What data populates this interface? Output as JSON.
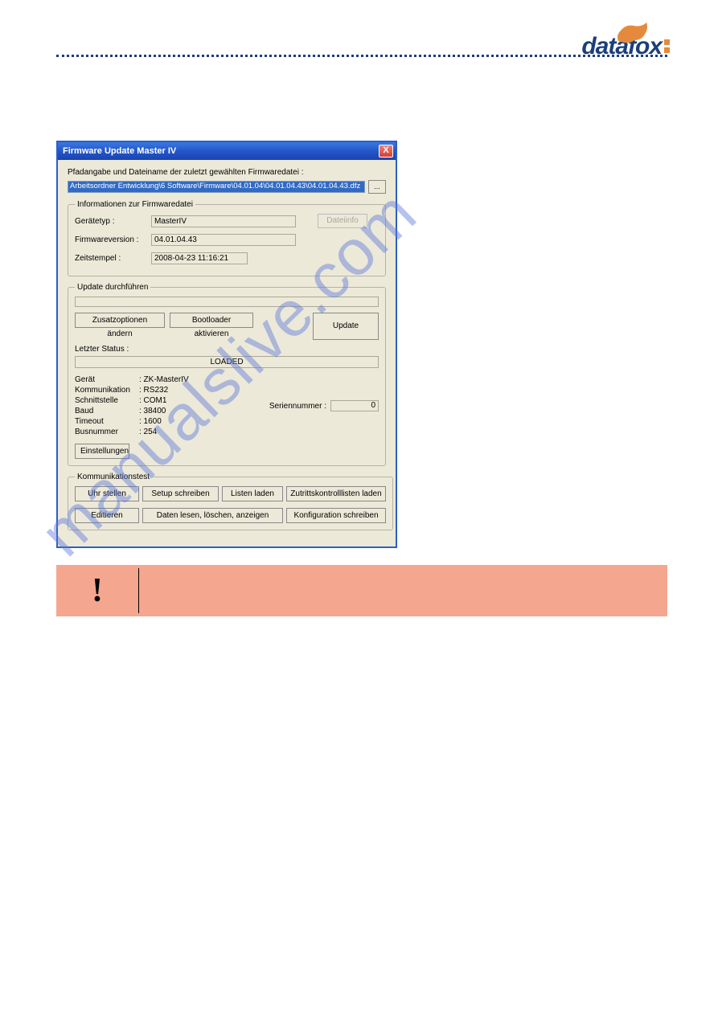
{
  "logo": {
    "text": "datafox"
  },
  "dialog": {
    "title": "Firmware Update Master IV",
    "close_label": "X",
    "path_section_label": "Pfadangabe und Dateiname der zuletzt gewählten Firmwaredatei :",
    "path_value": "Arbeitsordner Entwicklung\\6 Software\\Firmware\\04.01.04\\04.01.04.43\\04.01.04.43.dfz",
    "browse_label": "...",
    "info": {
      "legend": "Informationen zur Firmwaredatei",
      "type_label": "Gerätetyp :",
      "type_value": "MasterIV",
      "version_label": "Firmwareversion :",
      "version_value": "04.01.04.43",
      "timestamp_label": "Zeitstempel :",
      "timestamp_value": "2008-04-23 11:16:21",
      "dateinfo_label": "Dateiinfo"
    },
    "update": {
      "legend": "Update durchführen",
      "addopts_label": "Zusatzoptionen ändern",
      "bootloader_label": "Bootloader aktivieren",
      "update_label": "Update",
      "lastStatus_label": "Letzter Status :",
      "status_value": "LOADED",
      "device": {
        "geraet_label": "Gerät",
        "geraet_value": ": ZK-MasterIV",
        "komm_label": "Kommunikation",
        "komm_value": ": RS232",
        "schnitt_label": "Schnittstelle",
        "schnitt_value": ": COM1",
        "baud_label": "Baud",
        "baud_value": ": 38400",
        "timeout_label": "Timeout",
        "timeout_value": ": 1600",
        "bus_label": "Busnummer",
        "bus_value": ": 254"
      },
      "serial_label": "Seriennummer :",
      "serial_value": "0",
      "settings_label": "Einstellungen"
    },
    "comm": {
      "legend": "Kommunikationstest",
      "uhr_label": "Uhr stellen",
      "setup_label": "Setup schreiben",
      "listen_label": "Listen laden",
      "zutritt_label": "Zutrittskontrolllisten laden",
      "edit_label": "Editieren",
      "daten_label": "Daten lesen, löschen, anzeigen",
      "konfig_label": "Konfiguration schreiben"
    }
  },
  "caution": {
    "icon": "!"
  },
  "watermark": "manualslive.com"
}
